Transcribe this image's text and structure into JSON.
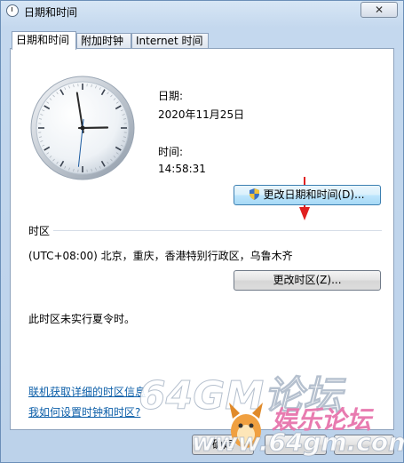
{
  "window": {
    "title": "日期和时间",
    "close_glyph": "✕"
  },
  "tabs": [
    {
      "label": "日期和时间",
      "active": true
    },
    {
      "label": "附加时钟",
      "active": false
    },
    {
      "label": "Internet 时间",
      "active": false
    }
  ],
  "clock": {
    "hour": 14,
    "minute": 58,
    "second": 31
  },
  "date": {
    "label": "日期:",
    "value": "2020年11月25日"
  },
  "time": {
    "label": "时间:",
    "value": "14:58:31"
  },
  "change_datetime_button": "更改日期和时间(D)...",
  "timezone": {
    "section_label": "时区",
    "value": "(UTC+08:00) 北京，重庆，香港特别行政区，乌鲁木齐",
    "change_button": "更改时区(Z)...",
    "dst_note": "此时区未实行夏令时。"
  },
  "links": {
    "online_info": "联机获取详细的时区信息",
    "how_to_set": "我如何设置时钟和时区?"
  },
  "bottom_buttons": {
    "ok": "确定"
  },
  "watermark": {
    "text1": "64GM论坛",
    "text2": "娱乐论坛",
    "url": "www.64gm.com"
  },
  "colors": {
    "link": "#0b5ea8",
    "arrow": "#e02020",
    "accent": "#3c7fb1"
  }
}
